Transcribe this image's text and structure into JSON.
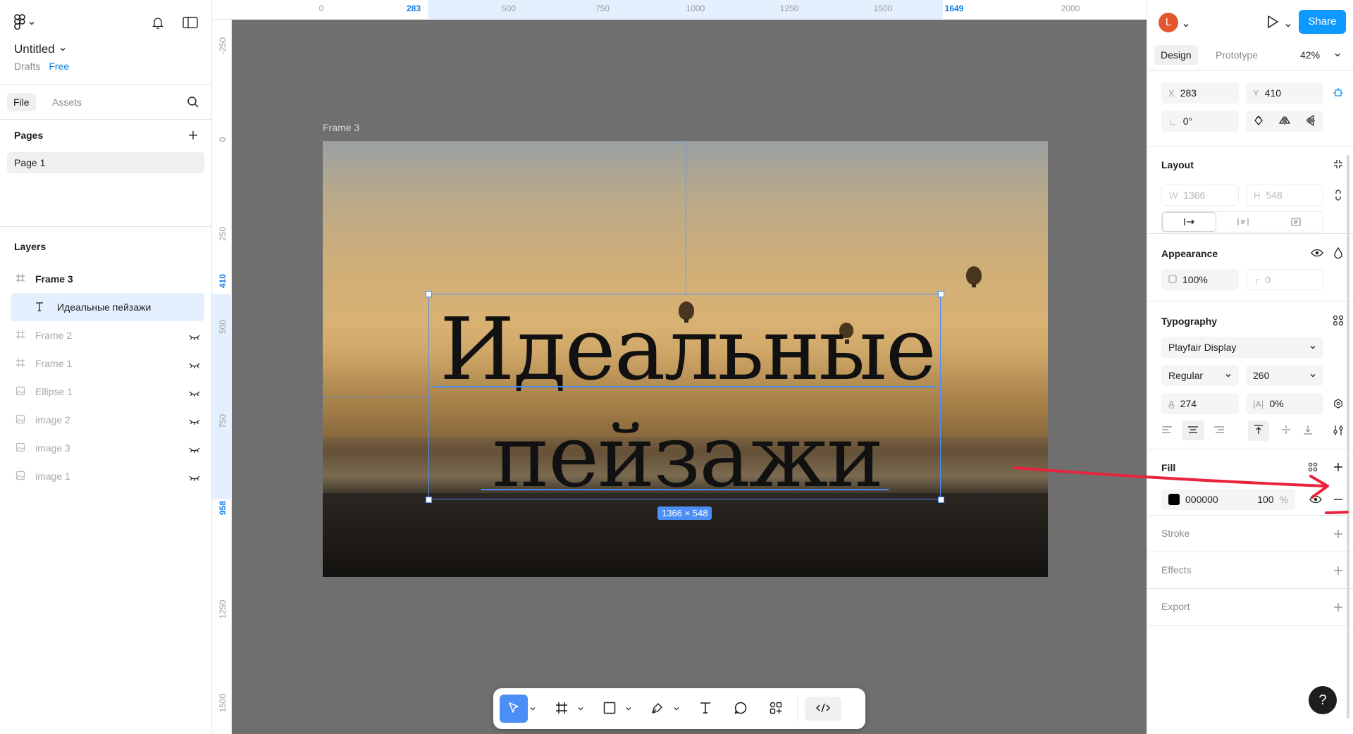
{
  "file": {
    "title": "Untitled",
    "location": "Drafts",
    "plan": "Free"
  },
  "left_tabs": [
    "File",
    "Assets"
  ],
  "pages": {
    "heading": "Pages",
    "items": [
      "Page 1"
    ]
  },
  "layers": {
    "heading": "Layers",
    "items": [
      {
        "name": "Frame 3",
        "icon": "frame-icon",
        "state": "visible"
      },
      {
        "name": "Идеальные пейзажи",
        "icon": "text-icon",
        "state": "selected"
      },
      {
        "name": "Frame 2",
        "icon": "frame-icon",
        "state": "hidden"
      },
      {
        "name": "Frame 1",
        "icon": "frame-icon",
        "state": "hidden"
      },
      {
        "name": "Ellipse 1",
        "icon": "image-icon",
        "state": "hidden"
      },
      {
        "name": "image 2",
        "icon": "image-icon",
        "state": "hidden"
      },
      {
        "name": "image 3",
        "icon": "image-icon",
        "state": "hidden"
      },
      {
        "name": "image 1",
        "icon": "image-icon",
        "state": "hidden"
      }
    ]
  },
  "ruler": {
    "top_labels": [
      "0",
      "283",
      "500",
      "750",
      "1000",
      "1250",
      "1500",
      "1649",
      "2000"
    ],
    "top_selected": [
      "283",
      "1649"
    ],
    "left_labels": [
      "-250",
      "0",
      "250",
      "410",
      "500",
      "750",
      "958",
      "1250",
      "1500"
    ],
    "left_selected": [
      "410",
      "958"
    ]
  },
  "canvas": {
    "frame_label": "Frame 3",
    "frame_text_line1": "Идеальные",
    "frame_text_line2": "пейзажи",
    "size_badge": "1366 × 548"
  },
  "toolbar": {
    "tools": [
      "move-tool",
      "frame-tool",
      "rectangle-tool",
      "pen-tool",
      "text-tool",
      "comment-tool",
      "actions-tool",
      "dev-mode-toggle"
    ]
  },
  "right": {
    "avatar_letter": "L",
    "share_label": "Share",
    "tabs": [
      "Design",
      "Prototype"
    ],
    "zoom": "42%",
    "position": {
      "x_label": "X",
      "x": "283",
      "y_label": "Y",
      "y": "410",
      "rotation": "0°"
    },
    "layout": {
      "heading": "Layout",
      "w_label": "W",
      "w": "1366",
      "h_label": "H",
      "h": "548"
    },
    "appearance": {
      "heading": "Appearance",
      "opacity": "100%",
      "radius": "0"
    },
    "typography": {
      "heading": "Typography",
      "font_family": "Playfair Display",
      "font_style": "Regular",
      "font_size": "260",
      "line_height": "274",
      "letter_spacing": "0%"
    },
    "fill": {
      "heading": "Fill",
      "hex": "000000",
      "opacity": "100",
      "unit": "%",
      "swatch_color": "#000000"
    },
    "stroke": {
      "heading": "Stroke"
    },
    "effects": {
      "heading": "Effects"
    },
    "export": {
      "heading": "Export"
    },
    "help": "?"
  },
  "colors": {
    "accent": "#0d99ff",
    "selection": "#4b8ef5",
    "annotation": "#e8243c"
  }
}
